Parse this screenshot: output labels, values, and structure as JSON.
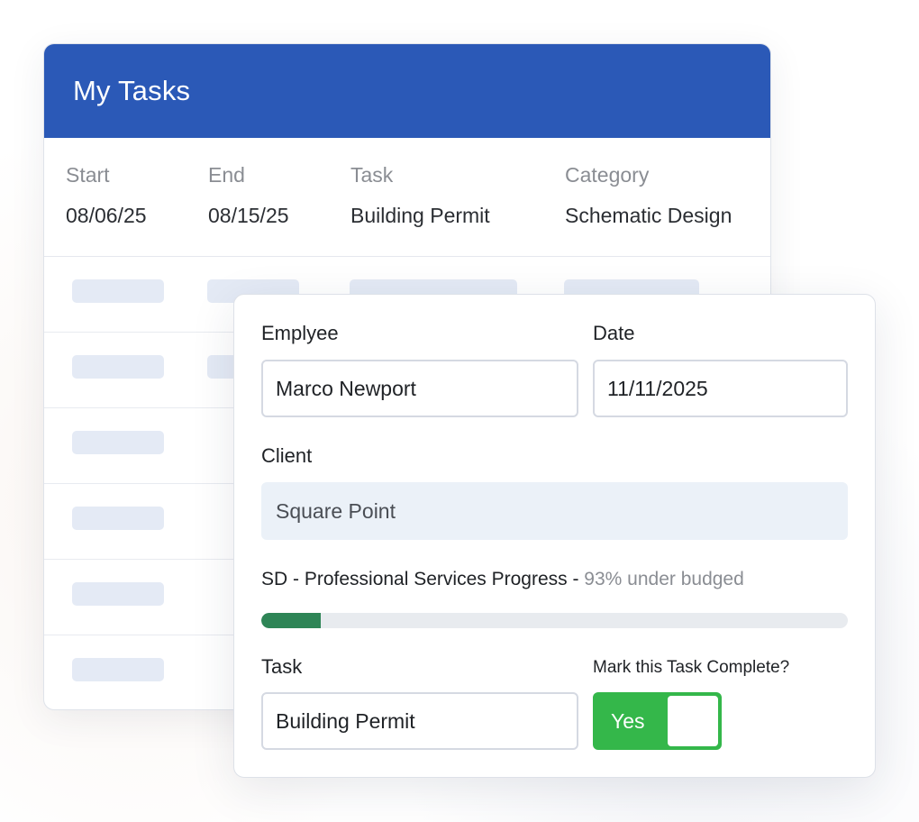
{
  "tasks_panel": {
    "title": "My Tasks",
    "columns": [
      "Start",
      "End",
      "Task",
      "Category"
    ],
    "row": [
      "08/06/25",
      "08/15/25",
      "Building Permit",
      "Schematic Design"
    ]
  },
  "form": {
    "employee_label": "Emplyee",
    "employee_value": "Marco Newport",
    "date_label": "Date",
    "date_value": "11/11/2025",
    "client_label": "Client",
    "client_value": "Square Point",
    "progress_label": "SD - Professional Services Progress - ",
    "progress_note": "93% under budged",
    "progress_fraction": 0.101,
    "task_label": "Task",
    "task_value": "Building Permit",
    "complete_label": "Mark this Task Complete?",
    "complete_toggle": "Yes"
  },
  "colors": {
    "header_blue": "#2b59b7",
    "progress_green": "#2e8556",
    "toggle_green": "#34b74a",
    "skeleton": "#e4eaf5"
  }
}
